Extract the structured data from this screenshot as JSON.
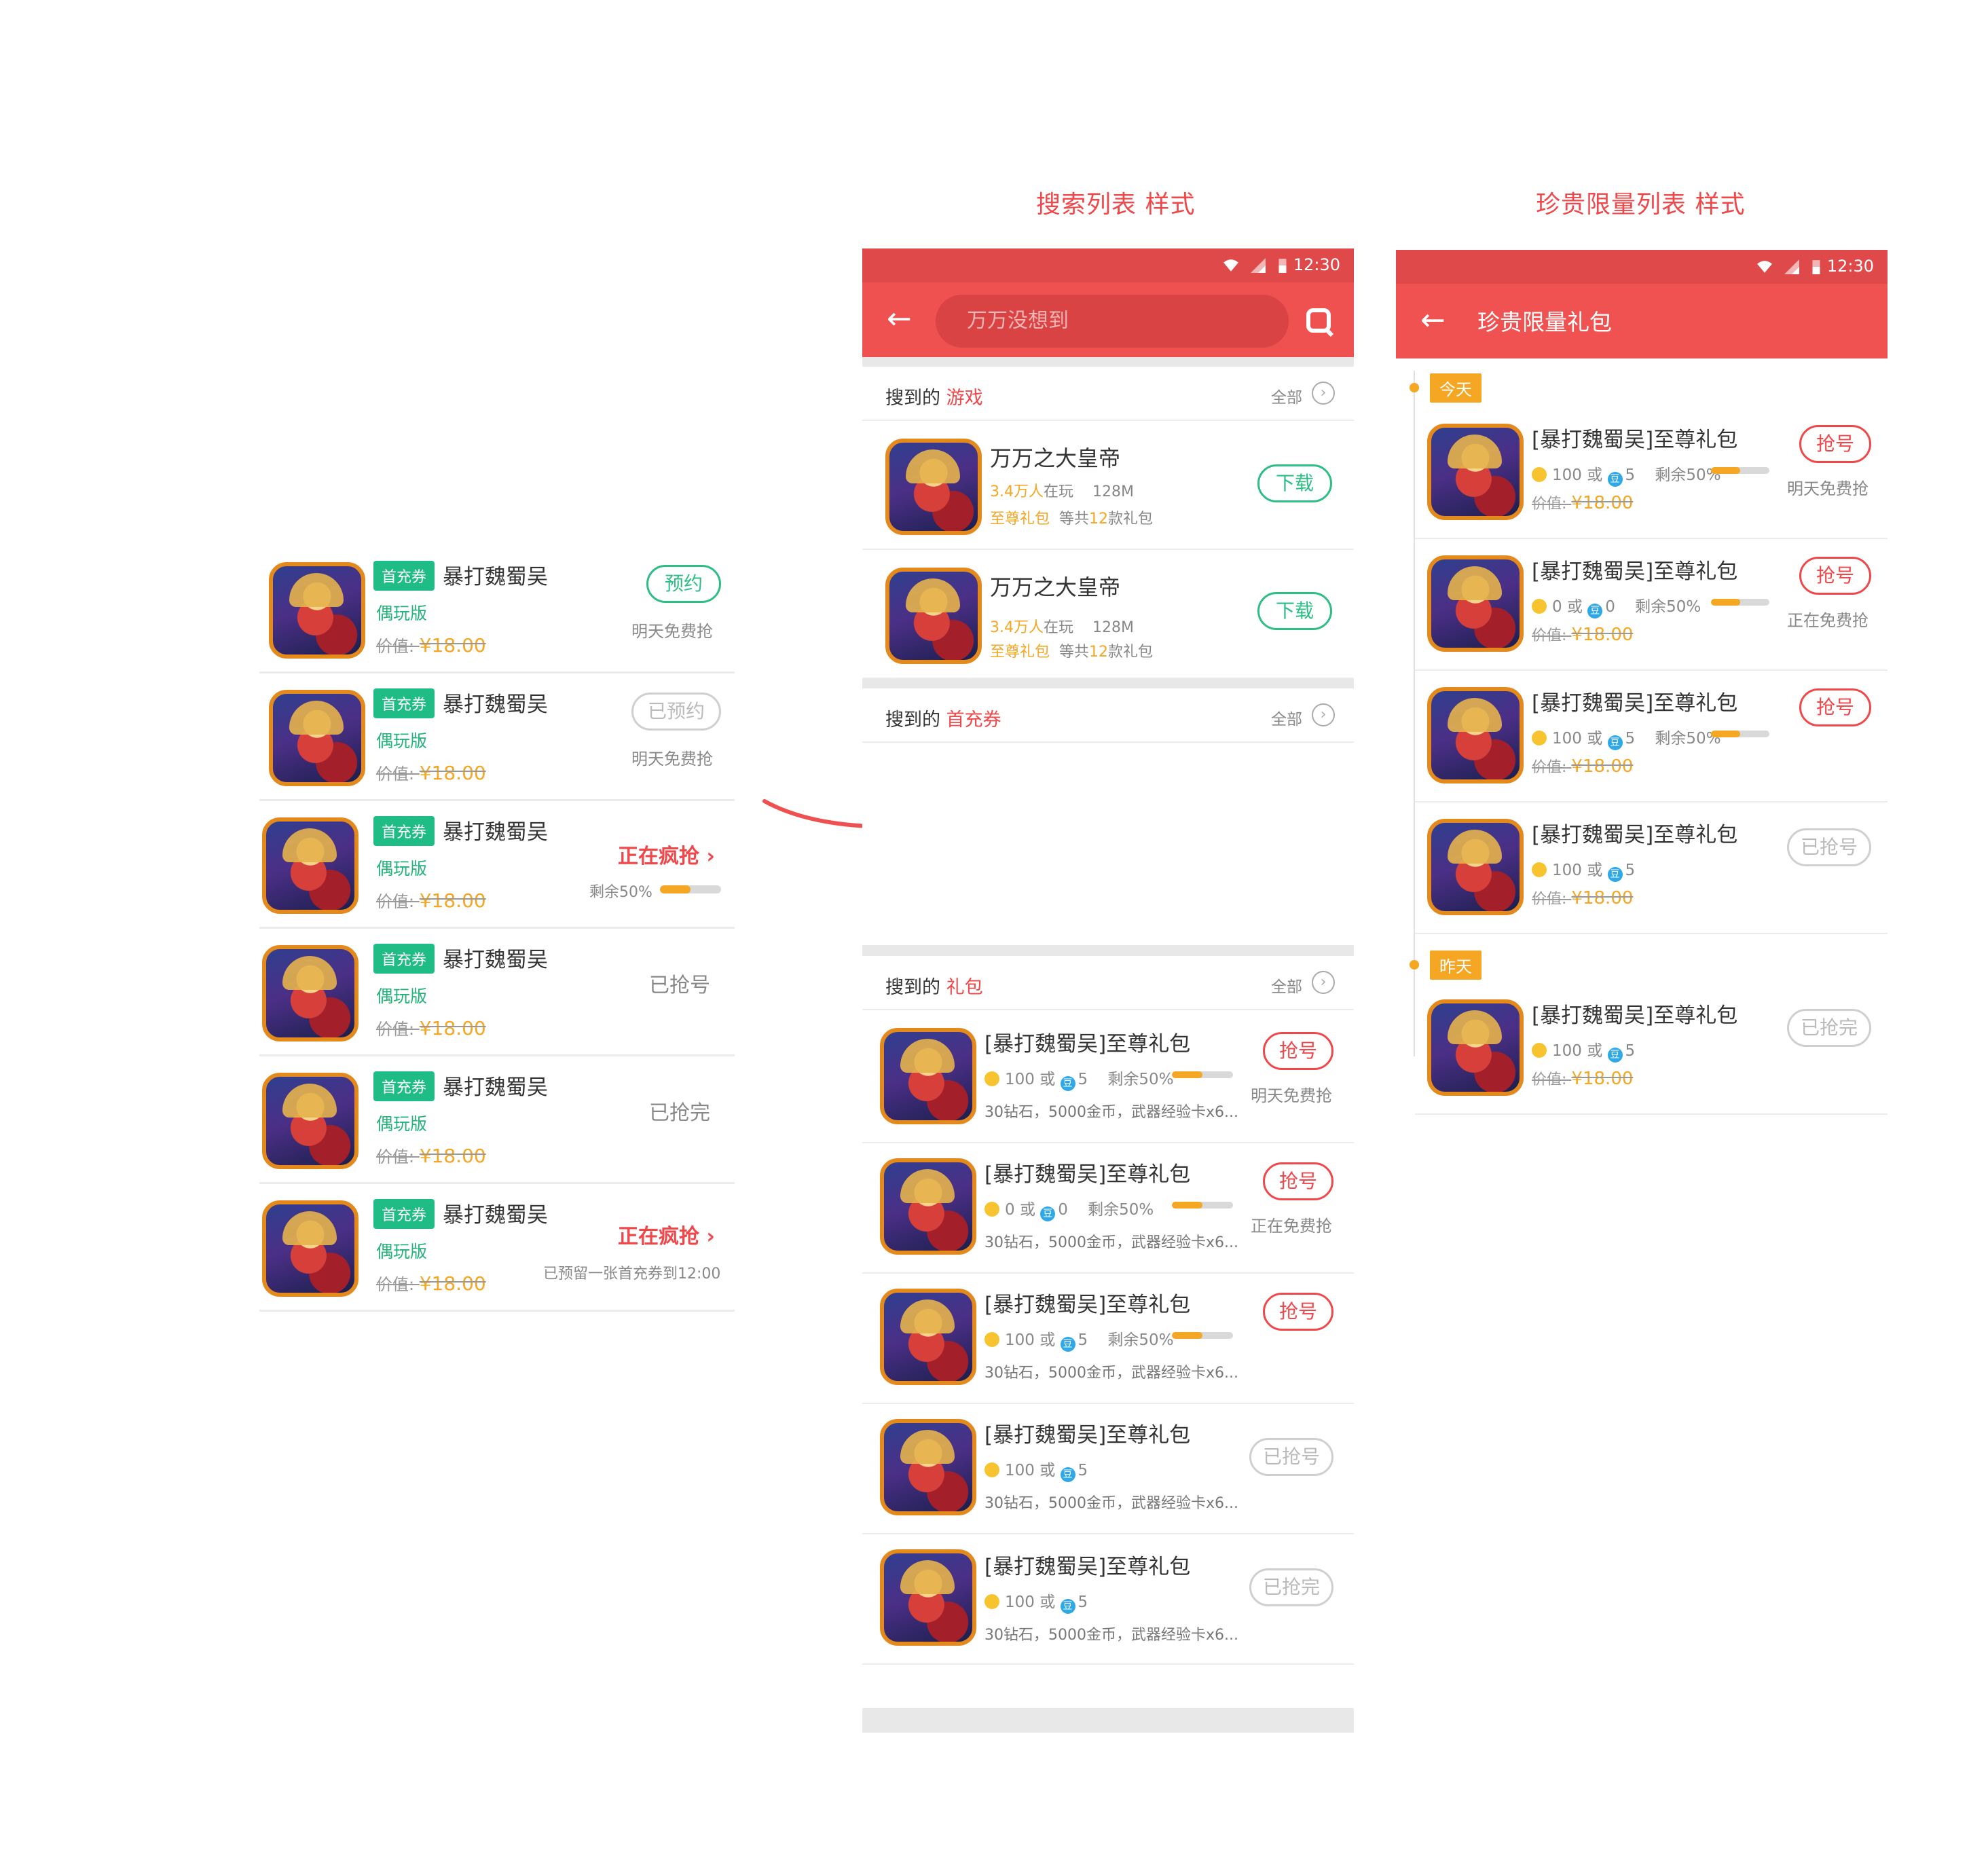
{
  "titles": {
    "search": "搜索列表 样式",
    "rare": "珍贵限量列表 样式"
  },
  "left": {
    "tag": "首充券",
    "game": "暴打魏蜀吴",
    "version": "偶玩版",
    "price_label": "价值:",
    "price": "¥18.00",
    "rows": [
      {
        "btn": "预约",
        "sub": "明天免费抢"
      },
      {
        "btn": "已预约",
        "sub": "明天免费抢"
      },
      {
        "hot": "正在疯抢 ›",
        "sub": "剩余50%",
        "progress": 0.5
      },
      {
        "status": "已抢号"
      },
      {
        "status": "已抢完"
      },
      {
        "hot": "正在疯抢 ›",
        "sub": "已预留一张首充券到12:00"
      }
    ]
  },
  "search": {
    "time": "12:30",
    "query": "万万没想到",
    "sections": {
      "games": {
        "prefix": "搜到的",
        "label": "游戏",
        "all": "全部"
      },
      "coupons": {
        "prefix": "搜到的",
        "label": "首充券",
        "all": "全部"
      },
      "gifts": {
        "prefix": "搜到的",
        "label": "礼包",
        "all": "全部"
      }
    },
    "games": [
      {
        "name": "万万之大皇帝",
        "players": "3.4万人",
        "playing": "在玩",
        "size": "128M",
        "gift": "至尊礼包",
        "total_pre": "等共",
        "total_num": "12",
        "total_post": "款礼包",
        "btn": "下载"
      },
      {
        "name": "万万之大皇帝",
        "players": "3.4万人",
        "playing": "在玩",
        "size": "128M",
        "gift": "至尊礼包",
        "total_pre": "等共",
        "total_num": "12",
        "total_post": "款礼包",
        "btn": "下载"
      }
    ],
    "gifts": [
      {
        "name": "[暴打魏蜀吴]至尊礼包",
        "coin": "100",
        "or": "或",
        "bean": "5",
        "remain": "剩余50%",
        "progress": 0.5,
        "desc": "30钻石，5000金币，武器经验卡x6...",
        "btn": "抢号",
        "sub": "明天免费抢"
      },
      {
        "name": "[暴打魏蜀吴]至尊礼包",
        "coin": "0",
        "or": "或",
        "bean": "0",
        "remain": "剩余50%",
        "progress": 0.5,
        "desc": "30钻石，5000金币，武器经验卡x6...",
        "btn": "抢号",
        "sub": "正在免费抢"
      },
      {
        "name": "[暴打魏蜀吴]至尊礼包",
        "coin": "100",
        "or": "或",
        "bean": "5",
        "remain": "剩余50%",
        "progress": 0.5,
        "desc": "30钻石，5000金币，武器经验卡x6...",
        "btn": "抢号",
        "sub": ""
      },
      {
        "name": "[暴打魏蜀吴]至尊礼包",
        "coin": "100",
        "or": "或",
        "bean": "5",
        "remain": "",
        "desc": "30钻石，5000金币，武器经验卡x6...",
        "btn": "已抢号",
        "sub": ""
      },
      {
        "name": "[暴打魏蜀吴]至尊礼包",
        "coin": "100",
        "or": "或",
        "bean": "5",
        "remain": "",
        "desc": "30钻石，5000金币，武器经验卡x6...",
        "btn": "已抢完",
        "sub": ""
      }
    ]
  },
  "rare": {
    "time": "12:30",
    "title": "珍贵限量礼包",
    "today": "今天",
    "yesterday": "昨天",
    "price_label": "价值:",
    "items": [
      {
        "name": "[暴打魏蜀吴]至尊礼包",
        "coin": "100",
        "or": "或",
        "bean": "5",
        "remain": "剩余50%",
        "progress": 0.5,
        "price": "¥18.00",
        "btn": "抢号",
        "sub": "明天免费抢"
      },
      {
        "name": "[暴打魏蜀吴]至尊礼包",
        "coin": "0",
        "or": "或",
        "bean": "0",
        "remain": "剩余50%",
        "progress": 0.5,
        "price": "¥18.00",
        "btn": "抢号",
        "sub": "正在免费抢"
      },
      {
        "name": "[暴打魏蜀吴]至尊礼包",
        "coin": "100",
        "or": "或",
        "bean": "5",
        "remain": "剩余50%",
        "progress": 0.5,
        "price": "¥18.00",
        "btn": "抢号",
        "sub": ""
      },
      {
        "name": "[暴打魏蜀吴]至尊礼包",
        "coin": "100",
        "or": "或",
        "bean": "5",
        "remain": "",
        "price": "¥18.00",
        "btn": "已抢号",
        "sub": ""
      },
      {
        "name": "[暴打魏蜀吴]至尊礼包",
        "coin": "100",
        "or": "或",
        "bean": "5",
        "remain": "",
        "price": "¥18.00",
        "btn": "已抢完",
        "sub": ""
      }
    ]
  },
  "colors": {
    "brand_red": "#ef5050",
    "green": "#1fbc85",
    "orange": "#f5a623"
  }
}
